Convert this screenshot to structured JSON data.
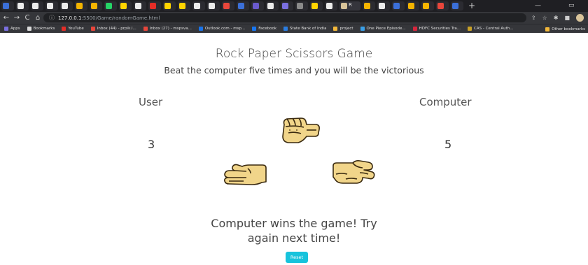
{
  "browser": {
    "active_tab_label": "R",
    "new_tab_symbol": "+",
    "url_host": "127.0.0.1",
    "url_path": ":5500/Game/randomGame.html",
    "info_icon": "info-icon",
    "back": "←",
    "forward": "→",
    "reload": "C",
    "home": "⌂",
    "window_minimize": "—",
    "bookmarks": [
      {
        "label": "Apps",
        "color": "#7a6fe0"
      },
      {
        "label": "Bookmarks",
        "color": "#dddddd"
      },
      {
        "label": "YouTube",
        "color": "#e52d27"
      },
      {
        "label": "Inbox (44) - prpik.l...",
        "color": "#e8463b"
      },
      {
        "label": "Inbox (27) - mspsva...",
        "color": "#e8463b"
      },
      {
        "label": "Outlook.com - msp...",
        "color": "#1a73e8"
      },
      {
        "label": "Facebook",
        "color": "#1877f2"
      },
      {
        "label": "State Bank of India",
        "color": "#2a7de1"
      },
      {
        "label": "project",
        "color": "#f3b83a"
      },
      {
        "label": "One Piece Episode...",
        "color": "#3aa0e8"
      },
      {
        "label": "HDFC Securities Tra...",
        "color": "#d7263d"
      },
      {
        "label": "CAS - Central Auth...",
        "color": "#c9a227"
      }
    ],
    "other_bookmarks": "Other bookmarks"
  },
  "game": {
    "title": "Rock Paper Scissors Game",
    "subtitle": "Beat the computer five times and you will be the victorious",
    "user_label": "User",
    "computer_label": "Computer",
    "user_score": "3",
    "computer_score": "5",
    "result_line1": "Computer wins the game! Try",
    "result_line2": "again next time!",
    "reset_label": "Reset"
  },
  "colors": {
    "reset_button": "#17c3dc",
    "skin": "#f1d58a",
    "skin_outline": "#3a2a10"
  }
}
